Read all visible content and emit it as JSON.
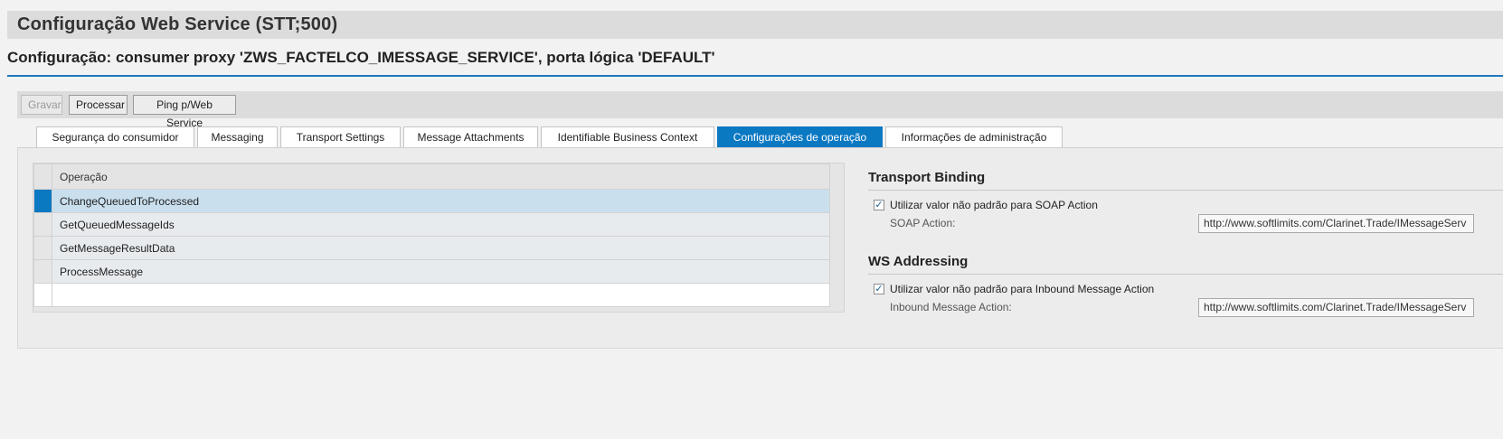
{
  "window": {
    "title": "Configuração Web Service (STT;500)"
  },
  "subtitle": "Configuração: consumer proxy 'ZWS_FACTELCO_IMESSAGE_SERVICE', porta lógica 'DEFAULT'",
  "toolbar": {
    "save_label": "Gravar",
    "process_label": "Processar",
    "ping_label": "Ping p/Web Service"
  },
  "tabs": [
    {
      "label": "Segurança do consumidor"
    },
    {
      "label": "Messaging"
    },
    {
      "label": "Transport Settings"
    },
    {
      "label": "Message Attachments"
    },
    {
      "label": "Identifiable Business Context"
    },
    {
      "label": "Configurações de operação",
      "active": true
    },
    {
      "label": "Informações de administração"
    }
  ],
  "operations_table": {
    "header": "Operação",
    "rows": [
      {
        "name": "ChangeQueuedToProcessed",
        "selected": true
      },
      {
        "name": "GetQueuedMessageIds"
      },
      {
        "name": "GetMessageResultData"
      },
      {
        "name": "ProcessMessage"
      }
    ]
  },
  "transport_binding": {
    "title": "Transport Binding",
    "checkbox_label": "Utilizar valor não padrão para SOAP Action",
    "checked": true,
    "field_label": "SOAP Action:",
    "field_value": "http://www.softlimits.com/Clarinet.Trade/IMessageServ"
  },
  "ws_addressing": {
    "title": "WS Addressing",
    "checkbox_label": "Utilizar valor não padrão para Inbound Message Action",
    "checked": true,
    "field_label": "Inbound Message Action:",
    "field_value": "http://www.softlimits.com/Clarinet.Trade/IMessageServ"
  },
  "colors": {
    "accent": "#0b78c2",
    "selected_row": "#c9dfee"
  }
}
